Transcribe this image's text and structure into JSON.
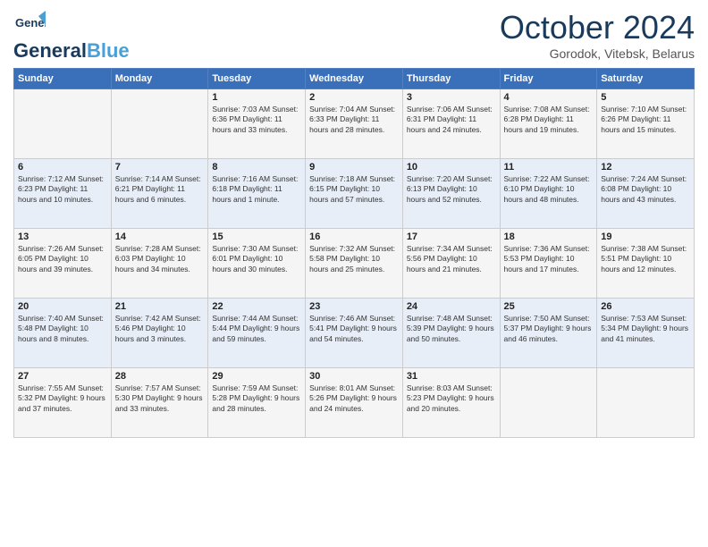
{
  "header": {
    "logo_general": "General",
    "logo_blue": "Blue",
    "month_title": "October 2024",
    "location": "Gorodok, Vitebsk, Belarus"
  },
  "weekdays": [
    "Sunday",
    "Monday",
    "Tuesday",
    "Wednesday",
    "Thursday",
    "Friday",
    "Saturday"
  ],
  "weeks": [
    [
      {
        "day": "",
        "content": ""
      },
      {
        "day": "",
        "content": ""
      },
      {
        "day": "1",
        "content": "Sunrise: 7:03 AM\nSunset: 6:36 PM\nDaylight: 11 hours\nand 33 minutes."
      },
      {
        "day": "2",
        "content": "Sunrise: 7:04 AM\nSunset: 6:33 PM\nDaylight: 11 hours\nand 28 minutes."
      },
      {
        "day": "3",
        "content": "Sunrise: 7:06 AM\nSunset: 6:31 PM\nDaylight: 11 hours\nand 24 minutes."
      },
      {
        "day": "4",
        "content": "Sunrise: 7:08 AM\nSunset: 6:28 PM\nDaylight: 11 hours\nand 19 minutes."
      },
      {
        "day": "5",
        "content": "Sunrise: 7:10 AM\nSunset: 6:26 PM\nDaylight: 11 hours\nand 15 minutes."
      }
    ],
    [
      {
        "day": "6",
        "content": "Sunrise: 7:12 AM\nSunset: 6:23 PM\nDaylight: 11 hours\nand 10 minutes."
      },
      {
        "day": "7",
        "content": "Sunrise: 7:14 AM\nSunset: 6:21 PM\nDaylight: 11 hours\nand 6 minutes."
      },
      {
        "day": "8",
        "content": "Sunrise: 7:16 AM\nSunset: 6:18 PM\nDaylight: 11 hours\nand 1 minute."
      },
      {
        "day": "9",
        "content": "Sunrise: 7:18 AM\nSunset: 6:15 PM\nDaylight: 10 hours\nand 57 minutes."
      },
      {
        "day": "10",
        "content": "Sunrise: 7:20 AM\nSunset: 6:13 PM\nDaylight: 10 hours\nand 52 minutes."
      },
      {
        "day": "11",
        "content": "Sunrise: 7:22 AM\nSunset: 6:10 PM\nDaylight: 10 hours\nand 48 minutes."
      },
      {
        "day": "12",
        "content": "Sunrise: 7:24 AM\nSunset: 6:08 PM\nDaylight: 10 hours\nand 43 minutes."
      }
    ],
    [
      {
        "day": "13",
        "content": "Sunrise: 7:26 AM\nSunset: 6:05 PM\nDaylight: 10 hours\nand 39 minutes."
      },
      {
        "day": "14",
        "content": "Sunrise: 7:28 AM\nSunset: 6:03 PM\nDaylight: 10 hours\nand 34 minutes."
      },
      {
        "day": "15",
        "content": "Sunrise: 7:30 AM\nSunset: 6:01 PM\nDaylight: 10 hours\nand 30 minutes."
      },
      {
        "day": "16",
        "content": "Sunrise: 7:32 AM\nSunset: 5:58 PM\nDaylight: 10 hours\nand 25 minutes."
      },
      {
        "day": "17",
        "content": "Sunrise: 7:34 AM\nSunset: 5:56 PM\nDaylight: 10 hours\nand 21 minutes."
      },
      {
        "day": "18",
        "content": "Sunrise: 7:36 AM\nSunset: 5:53 PM\nDaylight: 10 hours\nand 17 minutes."
      },
      {
        "day": "19",
        "content": "Sunrise: 7:38 AM\nSunset: 5:51 PM\nDaylight: 10 hours\nand 12 minutes."
      }
    ],
    [
      {
        "day": "20",
        "content": "Sunrise: 7:40 AM\nSunset: 5:48 PM\nDaylight: 10 hours\nand 8 minutes."
      },
      {
        "day": "21",
        "content": "Sunrise: 7:42 AM\nSunset: 5:46 PM\nDaylight: 10 hours\nand 3 minutes."
      },
      {
        "day": "22",
        "content": "Sunrise: 7:44 AM\nSunset: 5:44 PM\nDaylight: 9 hours\nand 59 minutes."
      },
      {
        "day": "23",
        "content": "Sunrise: 7:46 AM\nSunset: 5:41 PM\nDaylight: 9 hours\nand 54 minutes."
      },
      {
        "day": "24",
        "content": "Sunrise: 7:48 AM\nSunset: 5:39 PM\nDaylight: 9 hours\nand 50 minutes."
      },
      {
        "day": "25",
        "content": "Sunrise: 7:50 AM\nSunset: 5:37 PM\nDaylight: 9 hours\nand 46 minutes."
      },
      {
        "day": "26",
        "content": "Sunrise: 7:53 AM\nSunset: 5:34 PM\nDaylight: 9 hours\nand 41 minutes."
      }
    ],
    [
      {
        "day": "27",
        "content": "Sunrise: 7:55 AM\nSunset: 5:32 PM\nDaylight: 9 hours\nand 37 minutes."
      },
      {
        "day": "28",
        "content": "Sunrise: 7:57 AM\nSunset: 5:30 PM\nDaylight: 9 hours\nand 33 minutes."
      },
      {
        "day": "29",
        "content": "Sunrise: 7:59 AM\nSunset: 5:28 PM\nDaylight: 9 hours\nand 28 minutes."
      },
      {
        "day": "30",
        "content": "Sunrise: 8:01 AM\nSunset: 5:26 PM\nDaylight: 9 hours\nand 24 minutes."
      },
      {
        "day": "31",
        "content": "Sunrise: 8:03 AM\nSunset: 5:23 PM\nDaylight: 9 hours\nand 20 minutes."
      },
      {
        "day": "",
        "content": ""
      },
      {
        "day": "",
        "content": ""
      }
    ]
  ]
}
